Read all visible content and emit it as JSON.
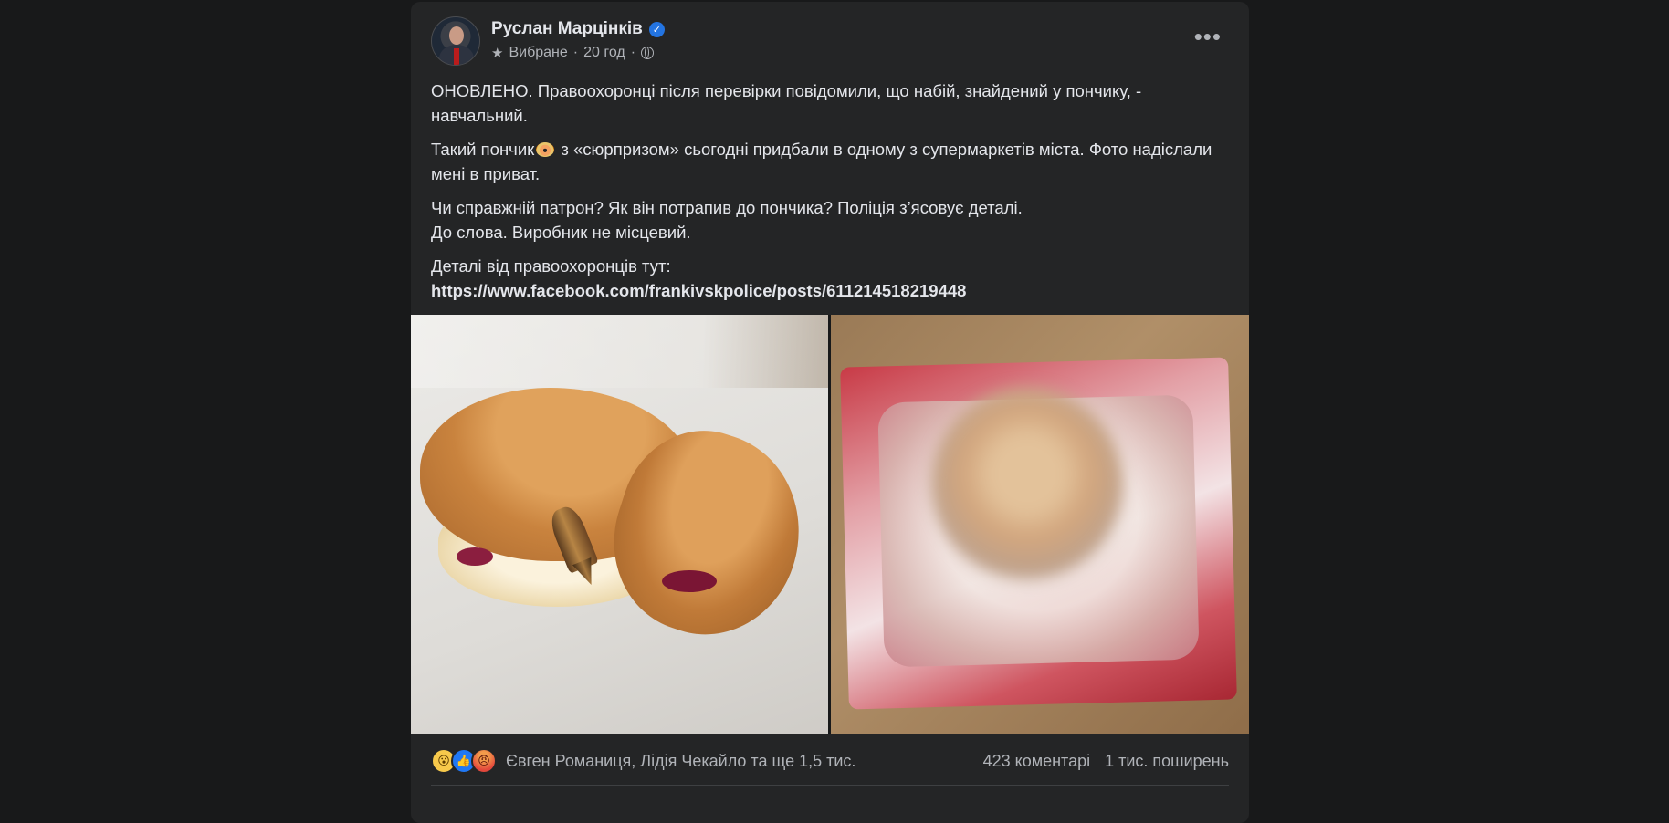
{
  "post": {
    "author": "Руслан Марцінків",
    "verified": true,
    "meta": {
      "list": "Вибране",
      "time": "20 год",
      "separator": "·",
      "audience_icon": "globe-icon"
    },
    "more_icon": "•••",
    "paragraphs": {
      "p1": "ОНОВЛЕНО. Правоохоронці після перевірки повідомили, що набій, знайдений у пончику, - навчальний.",
      "p2_before": "Такий пончик",
      "p2_after": " з «сюрпризом» сьогодні придбали в одному з супермаркетів міста. Фото надіслали мені в приват.",
      "p3_line1": "Чи справжній патрон? Як він потрапив до пончика? Поліція з’ясовує деталі.",
      "p3_line2": "До слова. Виробник не місцевий.",
      "p4_label": "Деталі від правоохоронців тут:",
      "p4_link": "https://www.facebook.com/frankivskpolice/posts/611214518219448"
    }
  },
  "reactions": {
    "types": [
      "wow",
      "like",
      "angry"
    ],
    "names": "Євген Романиця, Лідія Чекайло та ще 1,5 тис.",
    "comments": "423 коментарі",
    "shares": "1 тис. поширень"
  },
  "colors": {
    "background": "#18191a",
    "card": "#242526",
    "text": "#e4e6eb",
    "secondary": "#b0b3b8",
    "verified": "#2374e1"
  }
}
